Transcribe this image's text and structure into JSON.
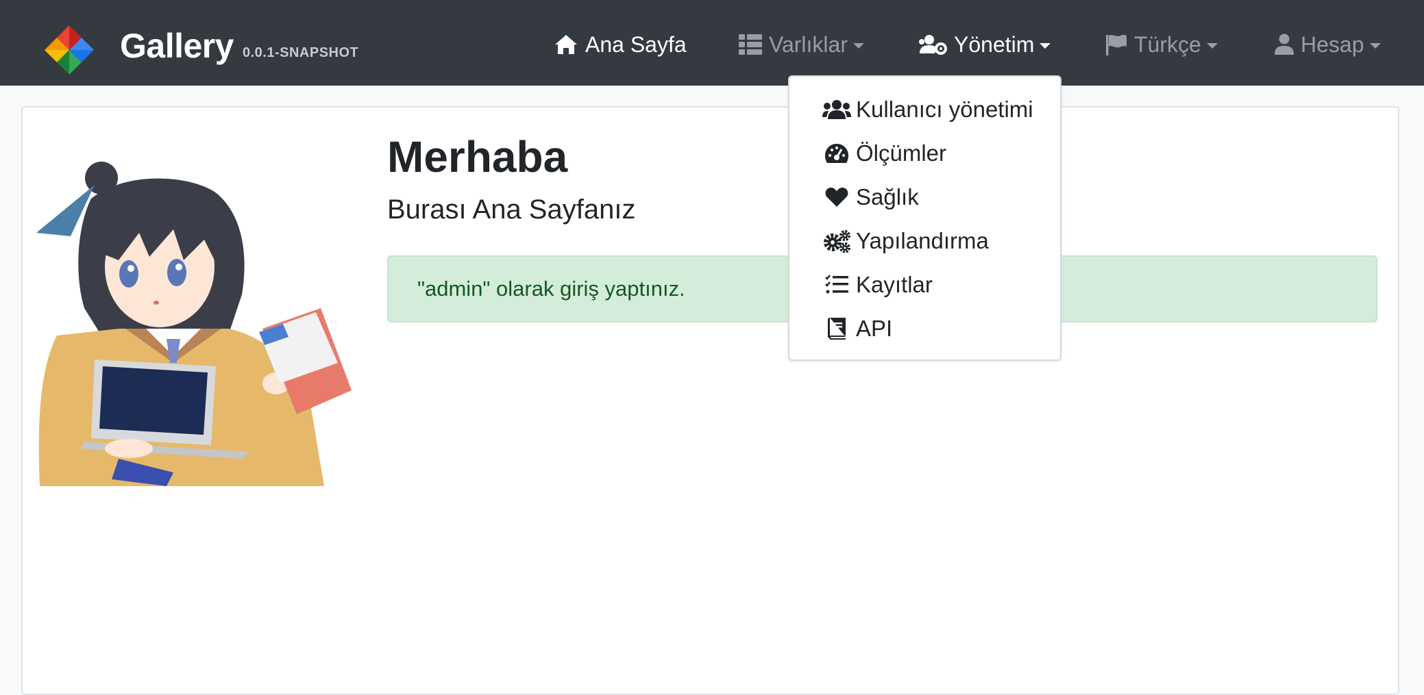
{
  "brand": {
    "title": "Gallery",
    "version": "0.0.1-SNAPSHOT"
  },
  "nav": {
    "home": "Ana Sayfa",
    "entities": "Varlıklar",
    "admin": "Yönetim",
    "language": "Türkçe",
    "account": "Hesap"
  },
  "admin_menu": {
    "items": [
      {
        "label": "Kullanıcı yönetimi",
        "icon": "users-icon"
      },
      {
        "label": "Ölçümler",
        "icon": "tachometer-icon"
      },
      {
        "label": "Sağlık",
        "icon": "heart-icon"
      },
      {
        "label": "Yapılandırma",
        "icon": "cogs-icon"
      },
      {
        "label": "Kayıtlar",
        "icon": "tasks-icon"
      },
      {
        "label": "API",
        "icon": "book-icon"
      }
    ]
  },
  "main": {
    "title": "Merhaba",
    "subtitle": "Burası Ana Sayfanız",
    "alert": "\"admin\" olarak giriş yaptınız."
  },
  "colors": {
    "navbar": "#343a40",
    "nav_active": "#ffffff",
    "nav_inactive": "#9a9da1",
    "alert_bg": "#d4edda",
    "alert_text": "#155724"
  }
}
